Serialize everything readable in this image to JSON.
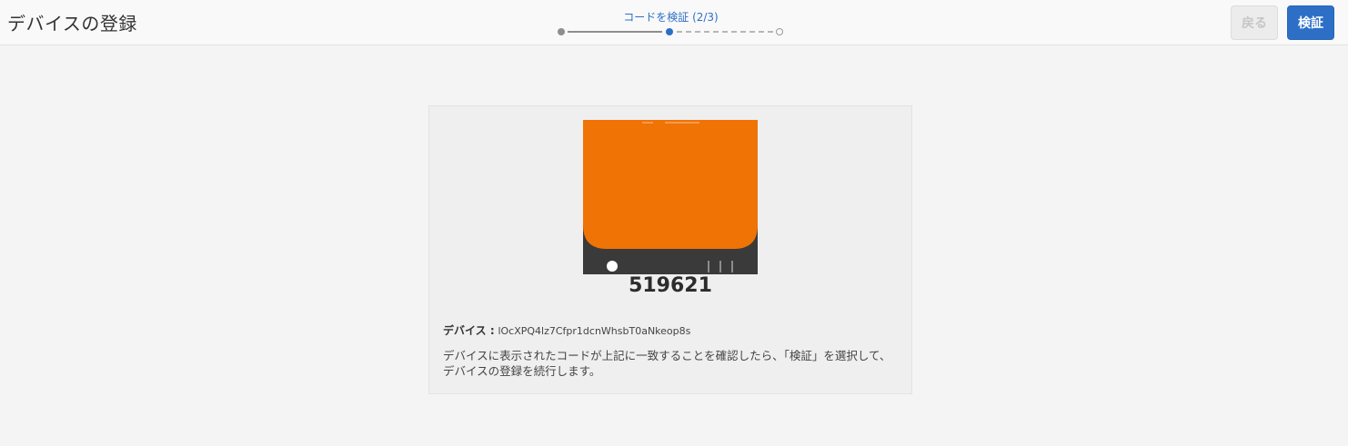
{
  "header": {
    "title": "デバイスの登録",
    "back_label": "戻る",
    "verify_label": "検証"
  },
  "stepper": {
    "label": "コードを検証 (2/3)",
    "current_step": 2,
    "total_steps": 3
  },
  "card": {
    "code": "519621",
    "device_label": "デバイス :",
    "device_id": "lOcXPQ4lz7Cfpr1dcnWhsbT0aNkeop8s",
    "instructions": "デバイスに表示されたコードが上記に一致することを確認したら、「検証」を選択して、デバイスの登録を続行します。"
  },
  "colors": {
    "accent": "#2d6fc7",
    "device_screen": "#f07306",
    "device_body": "#3a3a3a"
  }
}
